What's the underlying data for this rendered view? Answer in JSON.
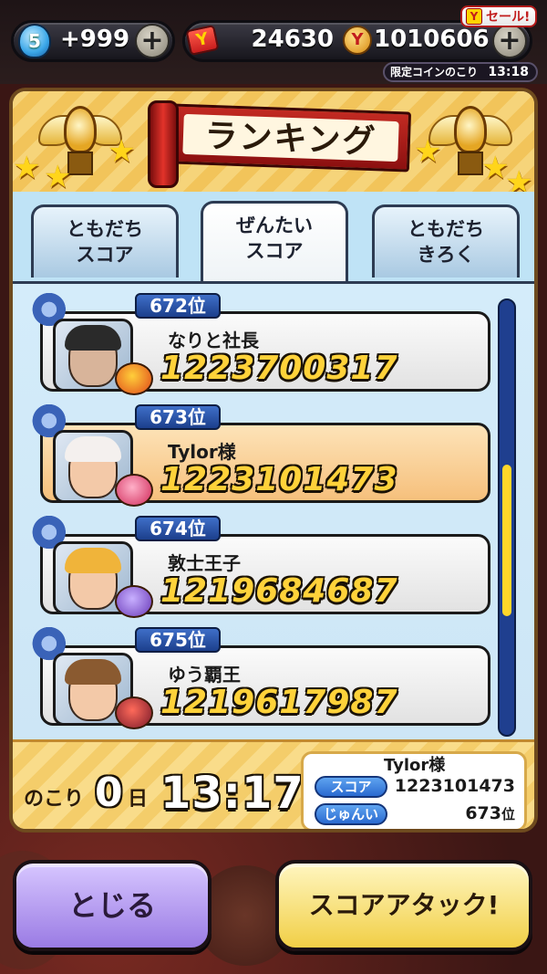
{
  "status_bar": {
    "stamina_level": "5",
    "stamina_value": "+999",
    "ticket_count": "24630",
    "coin_count": "1010606",
    "sale_badge": "セール!",
    "limited_coin_label": "限定コインのこり",
    "limited_coin_time": "13:18"
  },
  "header": {
    "title": "ランキング"
  },
  "tabs": [
    {
      "line1": "ともだち",
      "line2": "スコア"
    },
    {
      "line1": "ぜんたい",
      "line2": "スコア"
    },
    {
      "line1": "ともだち",
      "line2": "きろく"
    }
  ],
  "ranking": [
    {
      "rank": "672位",
      "name": "なりと社長",
      "score": "1223700317"
    },
    {
      "rank": "673位",
      "name": "Tylor様",
      "score": "1223101473"
    },
    {
      "rank": "674位",
      "name": "敦士王子",
      "score": "1219684687"
    },
    {
      "rank": "675位",
      "name": "ゆう覇王",
      "score": "1219617987"
    }
  ],
  "remaining": {
    "label": "のこり",
    "days": "0",
    "day_unit": "日",
    "time": "13:17"
  },
  "my_record": {
    "name": "Tylor様",
    "score_label": "スコア",
    "score": "1223101473",
    "rank_label": "じゅんい",
    "rank": "673",
    "rank_unit": "位"
  },
  "buttons": {
    "close": "とじる",
    "score_attack": "スコアアタック!"
  },
  "colors": {
    "accent_blue": "#1f3f8f",
    "highlight_row": "#f6c07c",
    "score_gold": "#ffd23a"
  }
}
